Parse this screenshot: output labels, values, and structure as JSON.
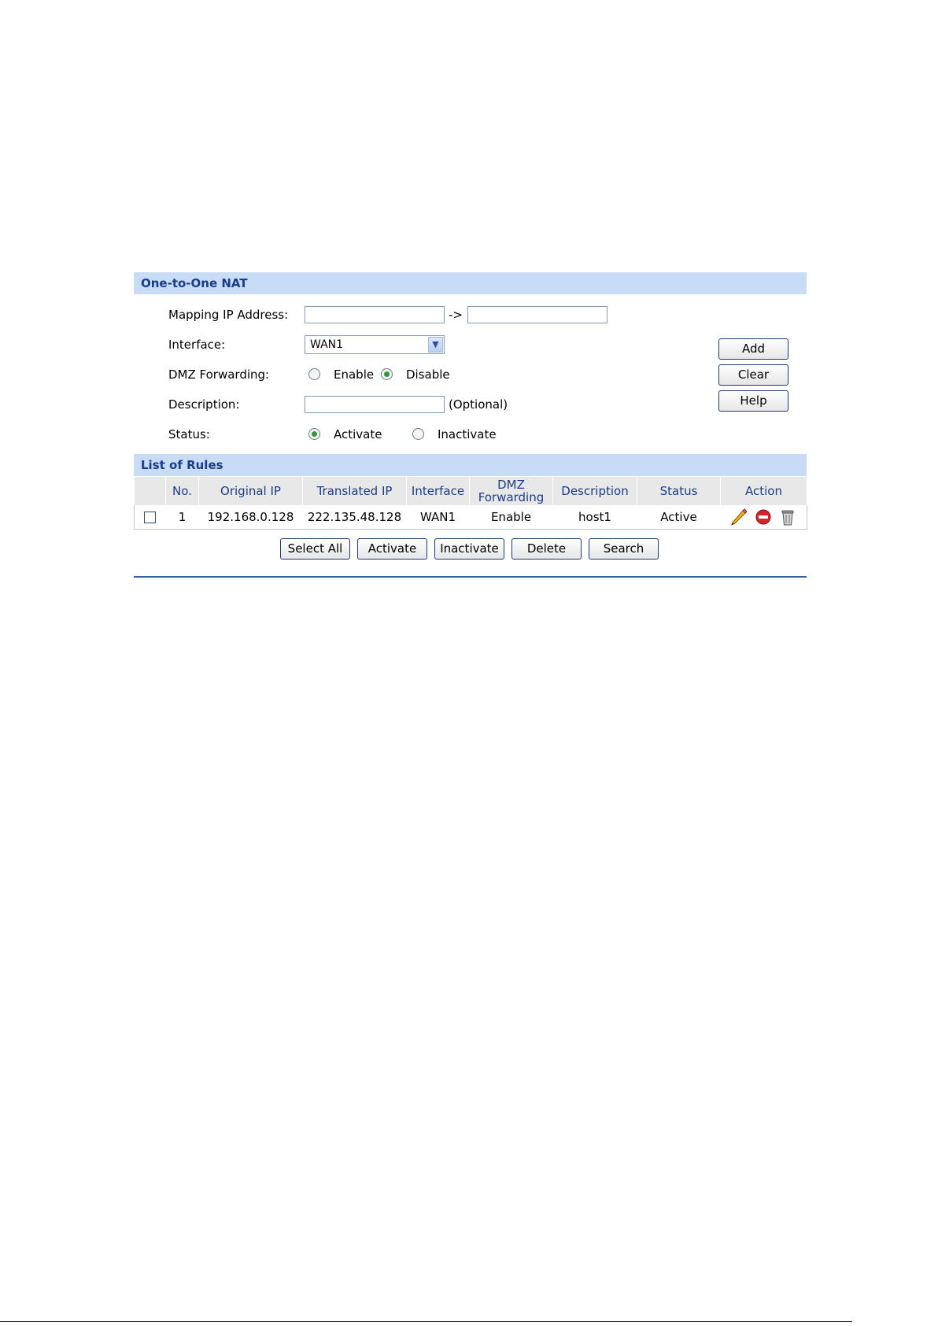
{
  "nat_section": {
    "title": "One-to-One NAT",
    "mapping_label": "Mapping IP Address:",
    "mapping_from_value": "",
    "mapping_arrow": "->",
    "mapping_to_value": "",
    "interface_label": "Interface:",
    "interface_selected": "WAN1",
    "dmz_label": "DMZ Forwarding:",
    "dmz_enable_label": "Enable",
    "dmz_disable_label": "Disable",
    "dmz_selected": "Disable",
    "description_label": "Description:",
    "description_value": "",
    "description_hint": "(Optional)",
    "status_label": "Status:",
    "status_activate_label": "Activate",
    "status_inactivate_label": "Inactivate",
    "status_selected": "Activate",
    "buttons": {
      "add": "Add",
      "clear": "Clear",
      "help": "Help"
    }
  },
  "rules_section": {
    "title": "List of Rules",
    "columns": [
      "",
      "No.",
      "Original IP",
      "Translated IP",
      "Interface",
      "DMZ Forwarding",
      "Description",
      "Status",
      "Action"
    ],
    "rows": [
      {
        "no": "1",
        "original_ip": "192.168.0.128",
        "translated_ip": "222.135.48.128",
        "interface": "WAN1",
        "dmz": "Enable",
        "description": "host1",
        "status": "Active",
        "actions": [
          "edit-icon",
          "disable-icon",
          "trash-icon"
        ]
      }
    ],
    "buttons": {
      "select_all": "Select All",
      "activate": "Activate",
      "inactivate": "Inactivate",
      "delete": "Delete",
      "search": "Search"
    }
  },
  "colors": {
    "header_bg": "#c8dcf8",
    "header_text": "#1a3c8c",
    "radio_dot": "#2f9a3a",
    "bottom_line": "#2e63a8"
  }
}
